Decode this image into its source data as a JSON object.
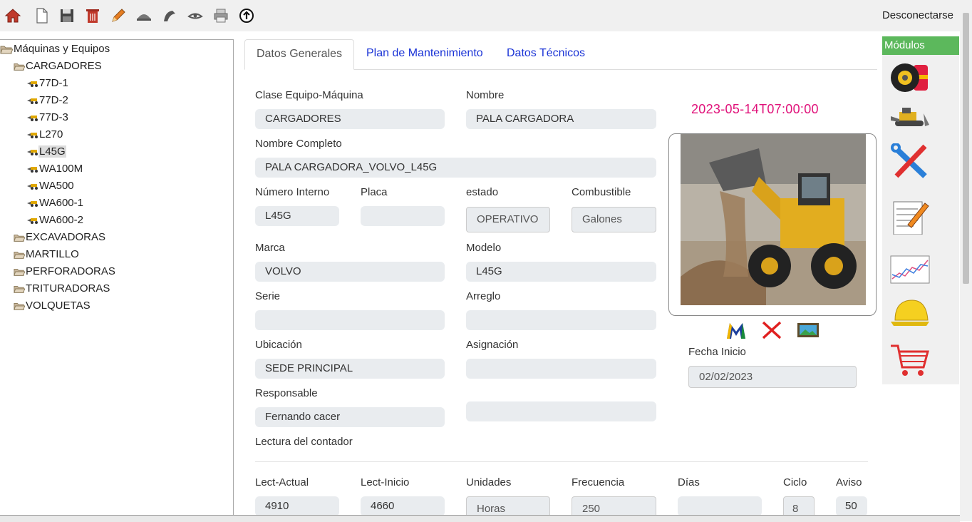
{
  "toolbar": {
    "icons": [
      "home-icon",
      "new-document-icon",
      "save-icon",
      "delete-icon",
      "edit-icon",
      "icon-6",
      "icon-7",
      "icon-8",
      "print-icon",
      "upload-icon"
    ],
    "logout_label": "Desconectarse"
  },
  "tree": {
    "root": "Máquinas y Equipos",
    "cargadores": "CARGADORES",
    "items": [
      "77D-1",
      "77D-2",
      "77D-3",
      "L270",
      "L45G",
      "WA100M",
      "WA500",
      "WA600-1",
      "WA600-2"
    ],
    "selected": "L45G",
    "folders": [
      "EXCAVADORAS",
      "MARTILLO",
      "PERFORADORAS",
      "TRITURADORAS",
      "VOLQUETAS"
    ]
  },
  "tabs": {
    "general": "Datos Generales",
    "plan": "Plan de Mantenimiento",
    "tecnicos": "Datos Técnicos"
  },
  "form": {
    "clase_label": "Clase Equipo-Máquina",
    "clase_value": "CARGADORES",
    "nombre_label": "Nombre",
    "nombre_value": "PALA CARGADORA",
    "nombre_completo_label": "Nombre Completo",
    "nombre_completo_value": "PALA CARGADORA_VOLVO_L45G",
    "numero_label": "Número Interno",
    "numero_value": "L45G",
    "placa_label": "Placa",
    "placa_value": "",
    "estado_label": "estado",
    "estado_value": "OPERATIVO",
    "combustible_label": "Combustible",
    "combustible_value": "Galones",
    "marca_label": "Marca",
    "marca_value": "VOLVO",
    "modelo_label": "Modelo",
    "modelo_value": "L45G",
    "serie_label": "Serie",
    "serie_value": "",
    "arreglo_label": "Arreglo",
    "arreglo_value": "",
    "ubicacion_label": "Ubicación",
    "ubicacion_value": "SEDE PRINCIPAL",
    "asignacion_label": "Asignación",
    "asignacion_value": "",
    "responsable_label": "Responsable",
    "responsable_value": "Fernando cacer",
    "extra_value": "",
    "lectura_label": "Lectura del contador"
  },
  "counter": {
    "lect_actual_label": "Lect-Actual",
    "lect_actual_value": "4910",
    "lect_inicio_label": "Lect-Inicio",
    "lect_inicio_value": "4660",
    "unidades_label": "Unidades",
    "unidades_value": "Horas",
    "frecuencia_label": "Frecuencia",
    "frecuencia_value": "250",
    "dias_label": "Días",
    "dias_value": "",
    "ciclo_label": "Ciclo",
    "ciclo_value": "8",
    "aviso_label": "Aviso",
    "aviso_value": "50"
  },
  "side": {
    "timestamp": "2023-05-14T07:00:00",
    "fecha_inicio_label": "Fecha Inicio",
    "fecha_inicio_value": "02/02/2023"
  },
  "modules": {
    "title": "Módulos",
    "icons": [
      "tires-fuel-icon",
      "bulldozer-icon",
      "tools-icon",
      "notepad-icon",
      "chart-icon",
      "helmet-icon",
      "cart-icon"
    ]
  },
  "colors": {
    "accent": "#1a33d6",
    "timestamp": "#e0127a",
    "modules_header": "#5cb85c"
  }
}
